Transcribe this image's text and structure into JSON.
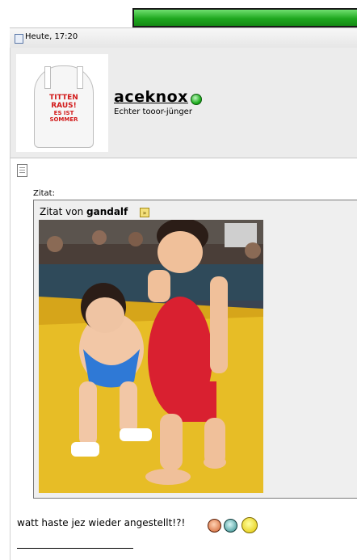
{
  "header": {
    "accent_color": "#1fa81f"
  },
  "post": {
    "timestamp": "Heute, 17:20",
    "author": {
      "name": "aceknox",
      "title": "Echter tooor-jünger",
      "online_status_color": "#22b122",
      "avatar": {
        "line1": "TITTEN",
        "line2": "RAUS!",
        "line3": "ES IST",
        "line4": "SOMMER"
      }
    },
    "quote": {
      "label": "Zitat:",
      "prefix": "Zitat von",
      "source": "gandalf",
      "goto_glyph": "»"
    },
    "message": "watt haste jez wieder angestellt!?!"
  },
  "icons": [
    "doc-icon",
    "post-icon",
    "online-status-icon",
    "goto-post-icon",
    "angry-smiley-icon",
    "grin-smiley-icon",
    "dizzy-smiley-icon"
  ]
}
